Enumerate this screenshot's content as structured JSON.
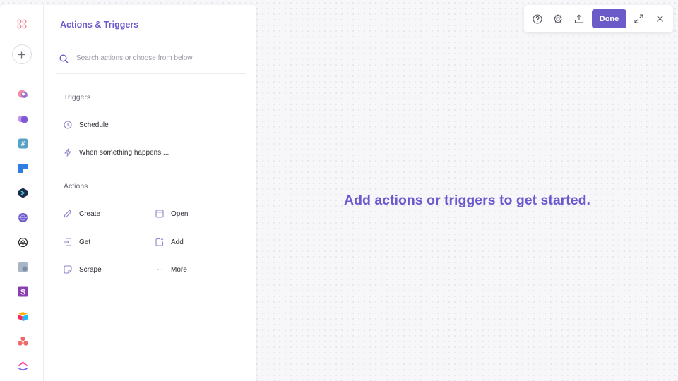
{
  "rail": {
    "apps": [
      {
        "icon": "app-icon-1",
        "color": "#e46f86"
      },
      {
        "icon": "app-icon-2",
        "color": "#8a63d2"
      },
      {
        "icon": "slack-icon",
        "color": "#4a8cb3"
      },
      {
        "icon": "trello-icon",
        "color": "#2f7de1"
      },
      {
        "icon": "codesandbox-icon",
        "color": "#1d2a4d"
      },
      {
        "icon": "globe-icon",
        "color": "#6b5bc8"
      },
      {
        "icon": "openai-icon",
        "color": "#222222"
      },
      {
        "icon": "app-icon-8",
        "color": "#8b9ab0"
      },
      {
        "icon": "app-icon-9",
        "color": "#8a3fb0"
      },
      {
        "icon": "airtable-icon",
        "color": "#f2b233"
      },
      {
        "icon": "asana-icon",
        "color": "#f06a6a"
      },
      {
        "icon": "clickup-icon",
        "color": "#7b68ee"
      }
    ],
    "slack_letter": "#",
    "purple_letter": "S"
  },
  "panel": {
    "title": "Actions & Triggers",
    "search_placeholder": "Search actions or choose from below",
    "triggers_label": "Triggers",
    "triggers": [
      {
        "label": "Schedule",
        "icon": "clock-icon"
      },
      {
        "label": "When something happens ...",
        "icon": "lightning-icon"
      }
    ],
    "actions_label": "Actions",
    "actions": [
      {
        "label": "Create",
        "icon": "pencil-icon"
      },
      {
        "label": "Open",
        "icon": "window-icon"
      },
      {
        "label": "Get",
        "icon": "enter-icon"
      },
      {
        "label": "Add",
        "icon": "add-icon"
      },
      {
        "label": "Scrape",
        "icon": "scrape-icon"
      },
      {
        "label": "More",
        "icon": "ellipsis-icon"
      }
    ],
    "more_glyph": "···"
  },
  "toolbar": {
    "done_label": "Done"
  },
  "canvas": {
    "empty_message": "Add actions or triggers to get started."
  },
  "colors": {
    "accent": "#6b5bc8",
    "icon_muted": "#8f86c9"
  }
}
